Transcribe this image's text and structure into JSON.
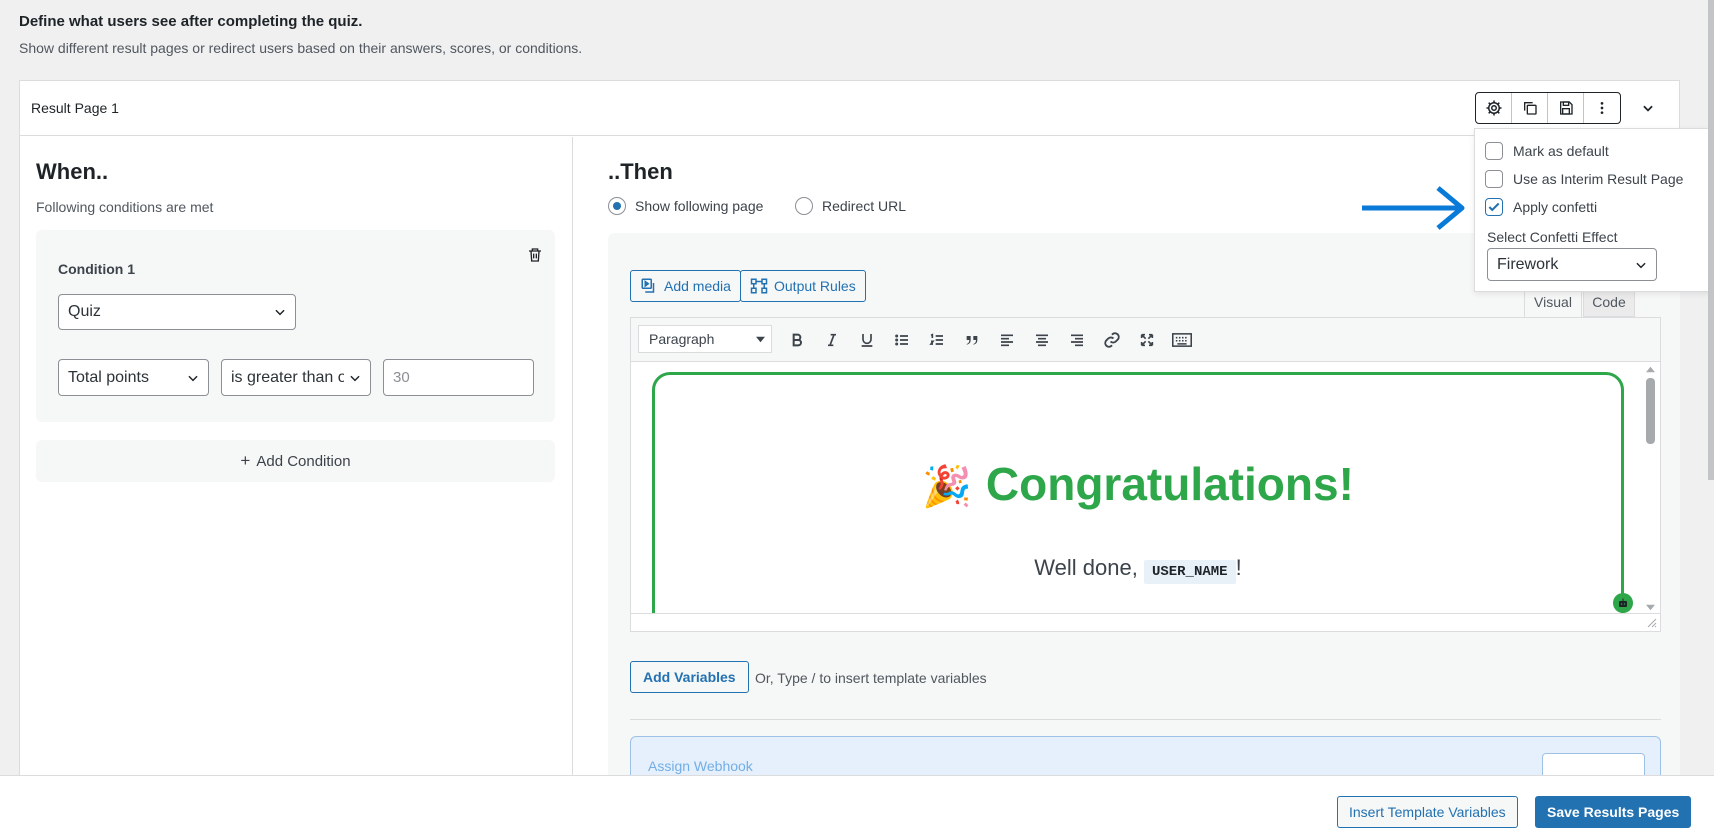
{
  "intro": {
    "title": "Define what users see after completing the quiz.",
    "subtitle": "Show different result pages or redirect users based on their answers, scores, or conditions."
  },
  "result_page": {
    "title": "Result Page 1",
    "toolbar_icons": [
      "gear-icon",
      "duplicate-icon",
      "save-icon",
      "more-vertical-icon"
    ],
    "collapse_icon": "chevron-down-icon"
  },
  "when": {
    "heading": "When..",
    "subheading": "Following conditions are met",
    "condition": {
      "title": "Condition 1",
      "source": "Quiz",
      "field": "Total points",
      "operator": "is greater than or",
      "value": "30"
    },
    "add_condition": "Add Condition",
    "add_condition_icon": "+"
  },
  "then": {
    "heading": "..Then",
    "options": {
      "show_page": "Show following page",
      "redirect": "Redirect URL"
    },
    "selected": "show_page"
  },
  "editor": {
    "add_media": "Add media",
    "output_rules": "Output Rules",
    "tab_visual": "Visual",
    "tab_code": "Code",
    "block_format": "Paragraph",
    "content": {
      "emoji": "🎉",
      "heading": "Congratulations!",
      "greeting_prefix": "Well done,",
      "variable": "USER_NAME",
      "greeting_suffix": "!"
    },
    "accent_color": "#2ea64a"
  },
  "variables": {
    "add_variables": "Add Variables",
    "hint": "Or, Type / to insert template variables"
  },
  "webhook": {
    "label": "Assign Webhook"
  },
  "footer": {
    "insert_template": "Insert Template Variables",
    "save": "Save Results Pages"
  },
  "settings_menu": {
    "mark_default": "Mark as default",
    "interim": "Use as Interim Result Page",
    "confetti": "Apply confetti",
    "confetti_checked": true,
    "effect_label": "Select Confetti Effect",
    "effect_value": "Firework"
  },
  "colors": {
    "primary": "#2271b1",
    "arrow": "#0a7ad8",
    "success": "#2ea64a"
  }
}
